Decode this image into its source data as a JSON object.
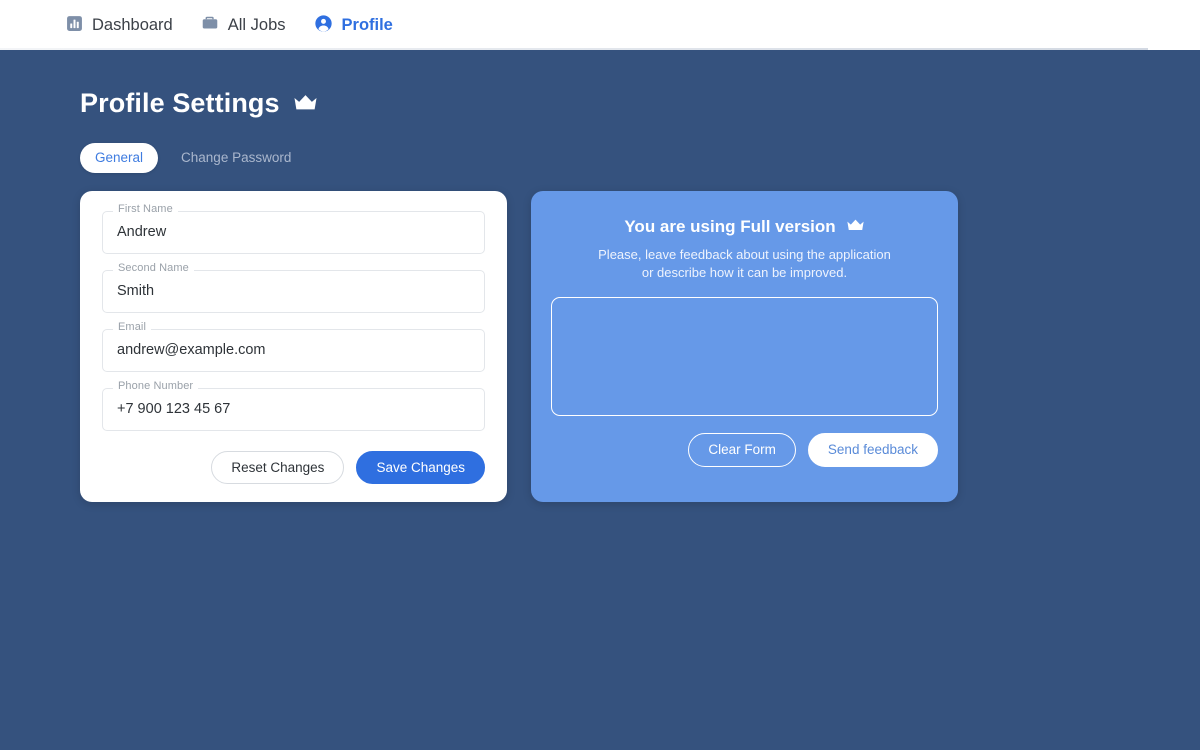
{
  "colors": {
    "page_background": "#35527e",
    "navbar_background": "#ffffff",
    "accent_blue": "#2f6fe0",
    "feedback_card": "#6699e8",
    "nav_icon_muted": "#7e8fa8",
    "card_white": "#ffffff",
    "tab_inactive_text": "#aab7cd"
  },
  "navbar": {
    "items": [
      {
        "label": "Dashboard",
        "icon": "bar-chart-icon",
        "active": false
      },
      {
        "label": "All Jobs",
        "icon": "briefcase-icon",
        "active": false
      },
      {
        "label": "Profile",
        "icon": "account-circle-icon",
        "active": true
      }
    ]
  },
  "page": {
    "title": "Profile Settings",
    "title_icon": "crown-icon"
  },
  "tabs": [
    {
      "label": "General",
      "active": true
    },
    {
      "label": "Change Password",
      "active": false
    }
  ],
  "form": {
    "fields": [
      {
        "label": "First Name",
        "value": "Andrew",
        "placeholder": ""
      },
      {
        "label": "Second Name",
        "value": "Smith",
        "placeholder": ""
      },
      {
        "label": "Email",
        "value": "andrew@example.com",
        "placeholder": ""
      },
      {
        "label": "Phone Number",
        "value": "+7 900 123 45 67",
        "placeholder": ""
      }
    ],
    "reset_label": "Reset Changes",
    "save_label": "Save Changes"
  },
  "feedback": {
    "title": "You are using Full version",
    "title_icon": "crown-icon",
    "subtitle_line1": "Please, leave feedback about using the application",
    "subtitle_line2": "or describe how it can be improved.",
    "textarea_value": "",
    "textarea_placeholder": "",
    "clear_label": "Clear Form",
    "send_label": "Send feedback"
  }
}
